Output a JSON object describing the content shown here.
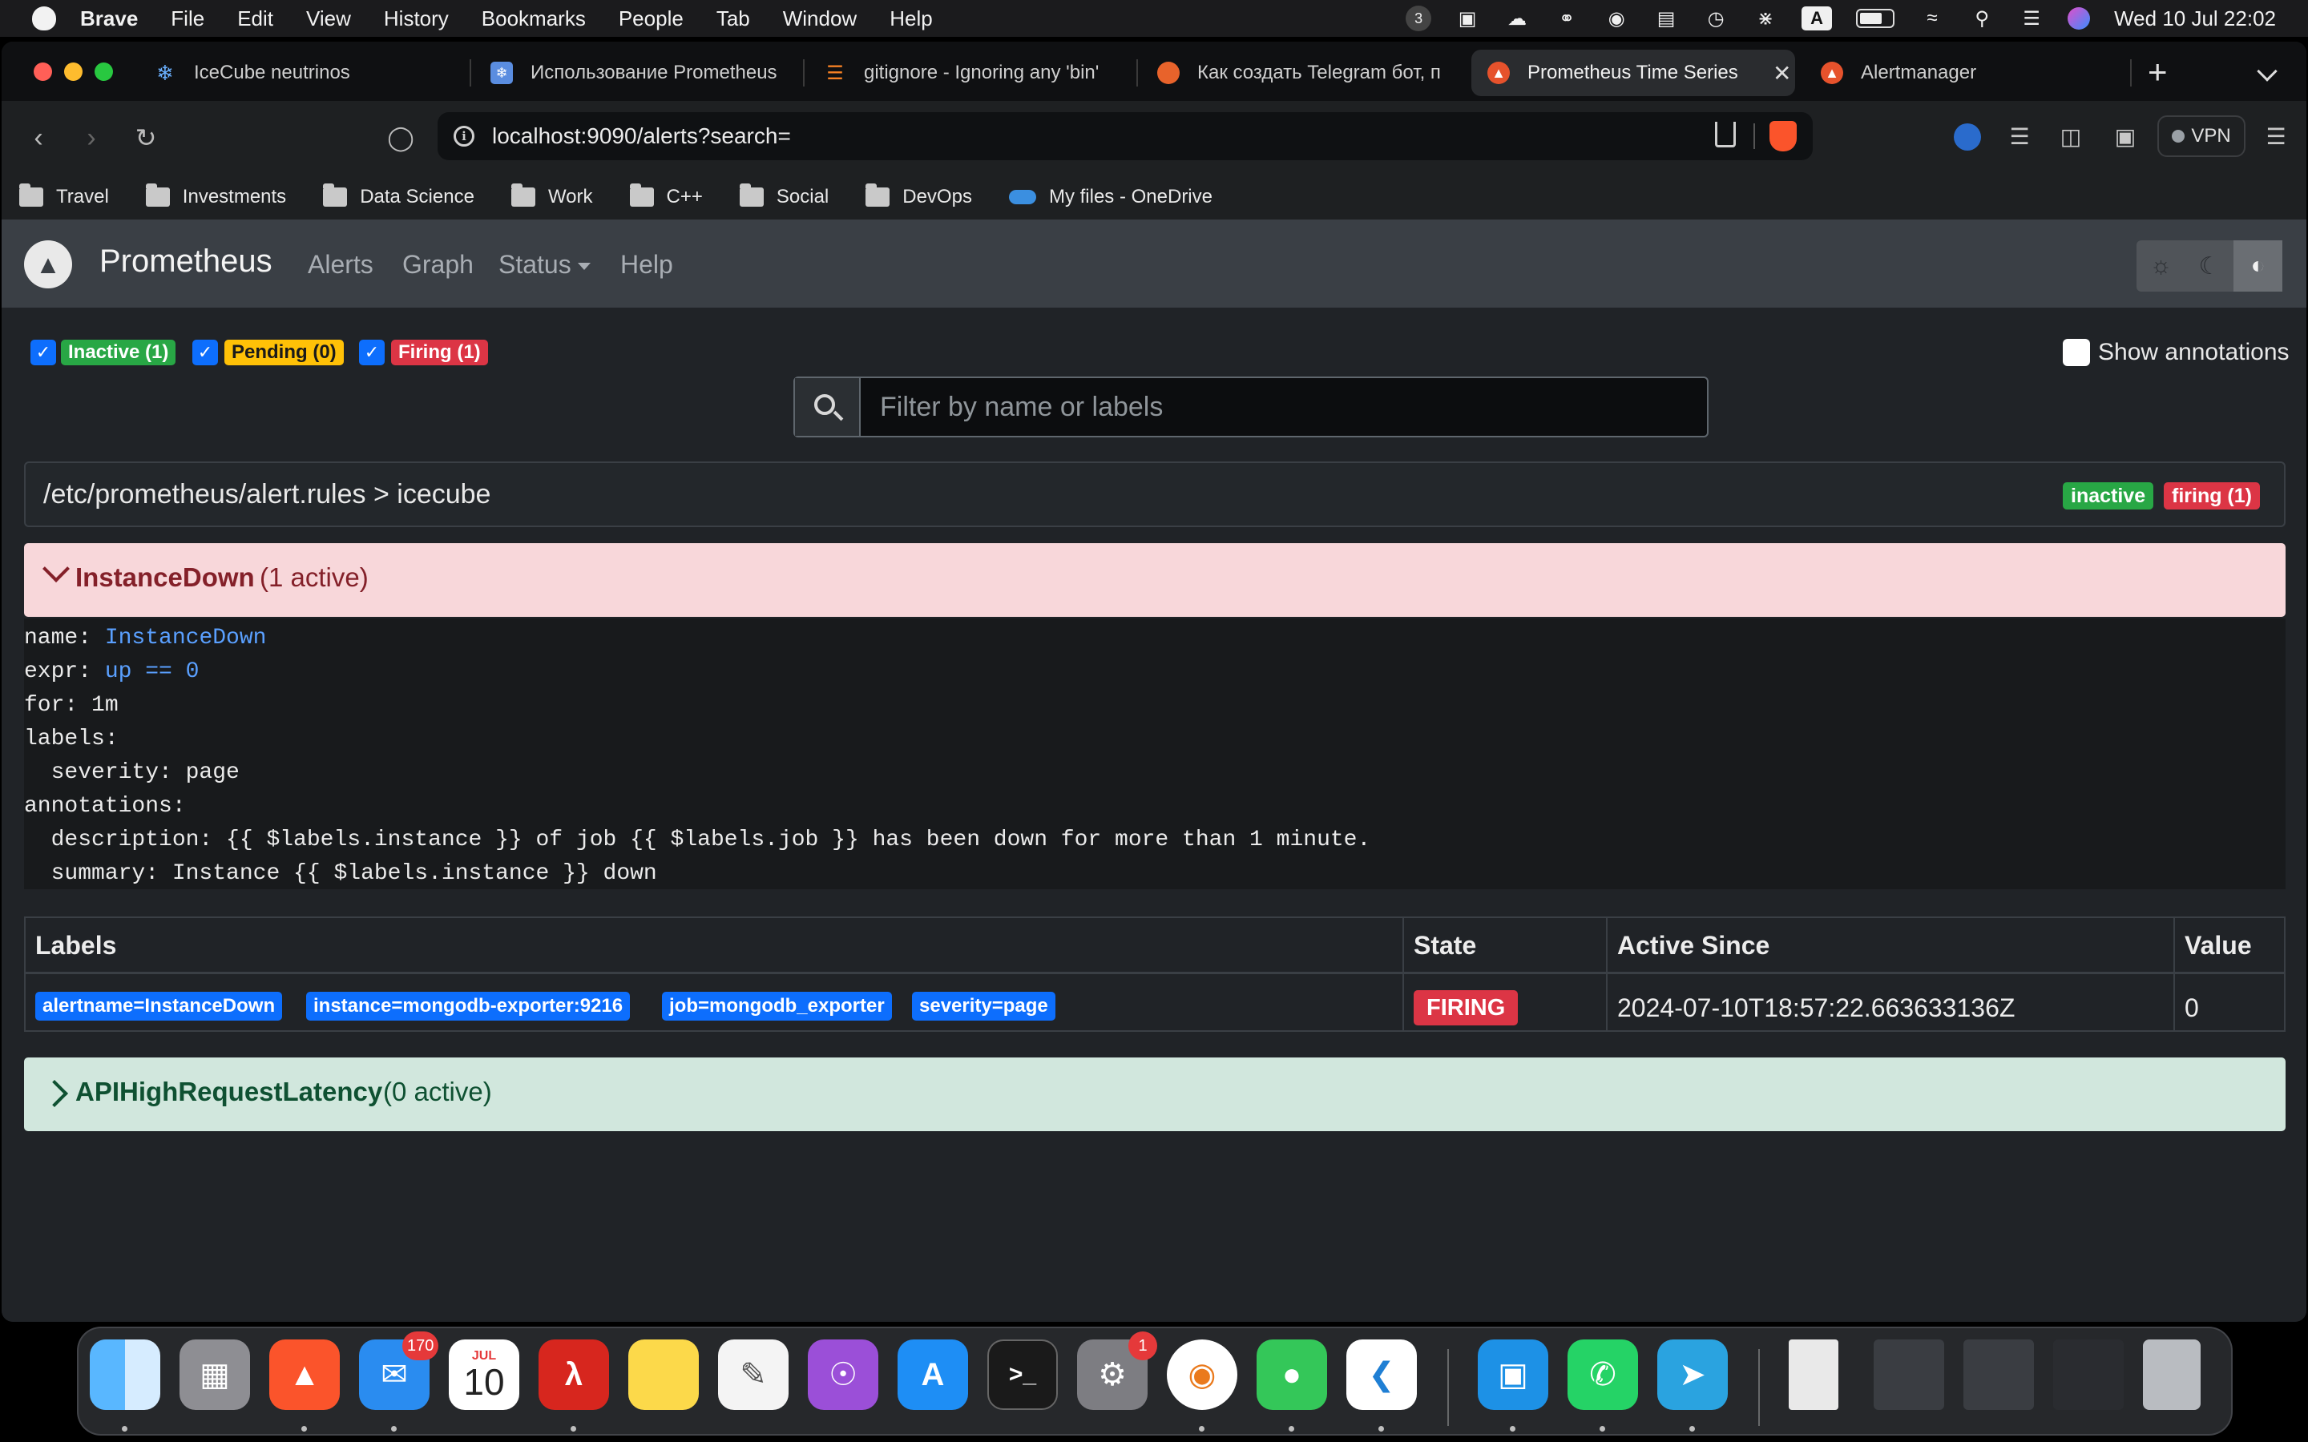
{
  "menubar": {
    "app": "Brave",
    "items": [
      "File",
      "Edit",
      "View",
      "History",
      "Bookmarks",
      "People",
      "Tab",
      "Window",
      "Help"
    ],
    "clock": "Wed 10 Jul  22:02",
    "input_source": "A",
    "badge_count": "3"
  },
  "tabs": [
    {
      "title": "IceCube neutrinos",
      "icon": "snowflake-icon",
      "color": "#3b82f6"
    },
    {
      "title": "Использование Prometheus",
      "icon": "page-icon",
      "color": "#5a8de0"
    },
    {
      "title": "gitignore - Ignoring any 'bin'",
      "icon": "stackoverflow-icon",
      "color": "#f48024"
    },
    {
      "title": "Как создать Telegram бот, п",
      "icon": "orange-circle-icon",
      "color": "#e8632b"
    },
    {
      "title": "Prometheus Time Series",
      "icon": "prometheus-icon",
      "color": "#e6522c",
      "active": true
    },
    {
      "title": "Alertmanager",
      "icon": "prometheus-icon",
      "color": "#e6522c"
    }
  ],
  "toolbar": {
    "url": "localhost:9090/alerts?search=",
    "vpn_label": "VPN"
  },
  "bookmarks": [
    {
      "label": "Travel",
      "type": "folder"
    },
    {
      "label": "Investments",
      "type": "folder"
    },
    {
      "label": "Data Science",
      "type": "folder"
    },
    {
      "label": "Work",
      "type": "folder"
    },
    {
      "label": "C++",
      "type": "folder"
    },
    {
      "label": "Social",
      "type": "folder"
    },
    {
      "label": "DevOps",
      "type": "folder"
    },
    {
      "label": "My files - OneDrive",
      "type": "cloud"
    }
  ],
  "prometheus": {
    "brand": "Prometheus",
    "nav": [
      "Alerts",
      "Graph",
      "Status",
      "Help"
    ],
    "filters": [
      {
        "label": "Inactive (1)",
        "color": "#28a745",
        "text_color": "#ffffff"
      },
      {
        "label": "Pending (0)",
        "color": "#ffc107",
        "text_color": "#1a1a1a"
      },
      {
        "label": "Firing (1)",
        "color": "#dc3545",
        "text_color": "#ffffff"
      }
    ],
    "search_placeholder": "Filter by name or labels",
    "show_annotations": "Show annotations",
    "group": {
      "path": "/etc/prometheus/alert.rules > icecube",
      "badges": [
        {
          "label": "inactive",
          "color": "#28a745"
        },
        {
          "label": "firing (1)",
          "color": "#dc3545"
        }
      ]
    },
    "rules": [
      {
        "name": "InstanceDown",
        "count": "(1 active)",
        "state": "firing",
        "bg": "#f8d7da",
        "fg": "#842029",
        "definition": {
          "name_key": "name:",
          "name_val": "InstanceDown",
          "expr_key": "expr:",
          "expr_val": "up == 0",
          "for_line": "for: 1m",
          "labels_key": "labels:",
          "severity_line": "  severity: page",
          "annotations_key": "annotations:",
          "description_line": "  description: {{ $labels.instance }} of job {{ $labels.job }} has been down for more than 1 minute.",
          "summary_line": "  summary: Instance {{ $labels.instance }} down"
        },
        "table": {
          "headers": [
            "Labels",
            "State",
            "Active Since",
            "Value"
          ],
          "labels": [
            "alertname=InstanceDown",
            "instance=mongodb-exporter:9216",
            "job=mongodb_exporter",
            "severity=page"
          ],
          "state": "FIRING",
          "active_since": "2024-07-10T18:57:22.663633136Z",
          "value": "0"
        }
      },
      {
        "name": "APIHighRequestLatency",
        "count": "(0 active)",
        "state": "inactive",
        "bg": "#d1e7dd",
        "fg": "#0f5132"
      }
    ]
  },
  "dock": {
    "apps": [
      "finder-icon",
      "launchpad-icon",
      "brave-icon",
      "mail-icon",
      "calendar-icon",
      "acrobat-icon",
      "notes-icon",
      "textedit-icon",
      "podcasts-icon",
      "appstore-icon",
      "terminal-icon",
      "system-settings-icon",
      "openvpn-icon",
      "messages-icon",
      "vscode-icon",
      "docker-icon",
      "whatsapp-icon",
      "telegram-icon"
    ],
    "mail_badge": "170",
    "settings_badge": "1",
    "calendar_month": "JUL",
    "calendar_day": "10"
  }
}
